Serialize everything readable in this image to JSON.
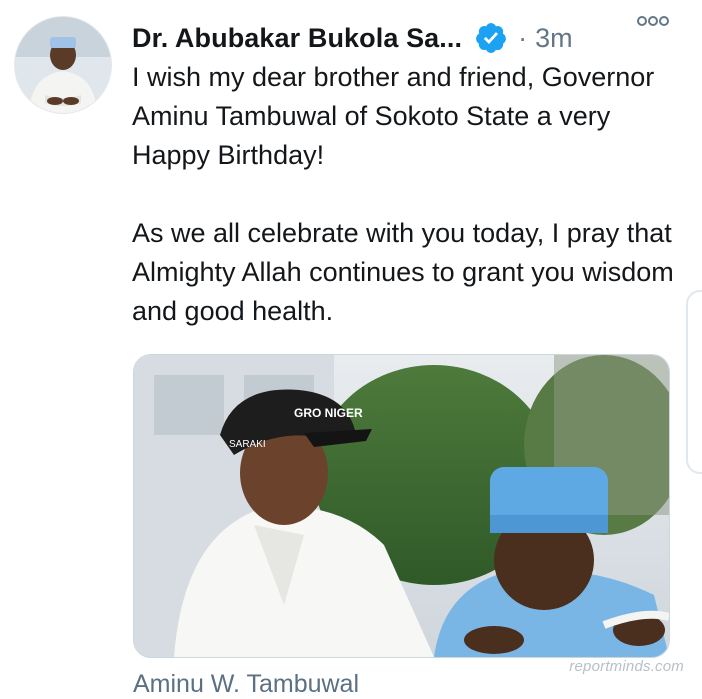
{
  "tweet": {
    "author_name": "Dr. Abubakar Bukola Sa...",
    "dot": "·",
    "time": "3m",
    "more_icon": "more-options-icon",
    "text": "I wish my dear brother and friend, Governor Aminu Tambuwal of Sokoto State a very Happy Birthday!\n\nAs we all celebrate with you today, I pray that Almighty Allah continues to grant you wisdom and good health.",
    "cap_text": "GRO NIGER",
    "cap_side_text": "SARAKI",
    "watermark": "reportminds.com",
    "tagged_person": "Aminu W. Tambuwal"
  },
  "colors": {
    "verified": "#1da1f2",
    "muted": "#657786",
    "caption": "#5b7083"
  }
}
